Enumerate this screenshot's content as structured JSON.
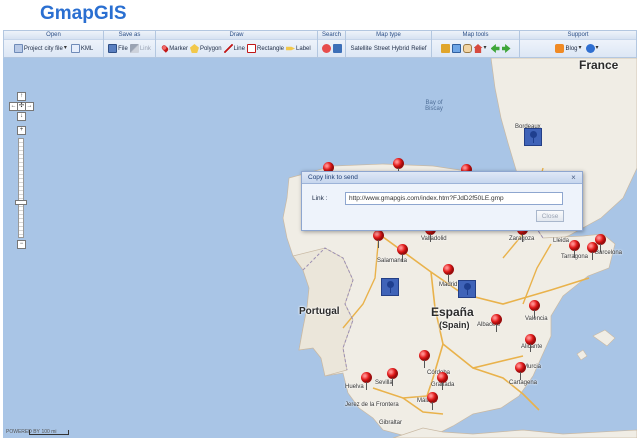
{
  "app": {
    "title": "GmapGIS"
  },
  "toolbar": {
    "groups": [
      {
        "title": "Open",
        "items": [
          {
            "label": "Project",
            "icon": "project-icon"
          },
          {
            "label": "city file",
            "icon": "dropdown-icon"
          },
          {
            "label": "KML",
            "icon": "kml-icon"
          }
        ]
      },
      {
        "title": "Save as",
        "items": [
          {
            "label": "File",
            "icon": "save-icon"
          },
          {
            "label": "Link",
            "icon": "link-icon",
            "disabled": true
          }
        ]
      },
      {
        "title": "Draw",
        "items": [
          {
            "label": "Marker",
            "icon": "marker-icon"
          },
          {
            "label": "Polygon",
            "icon": "polygon-icon"
          },
          {
            "label": "Line",
            "icon": "line-icon"
          },
          {
            "label": "Rectangle",
            "icon": "rectangle-icon"
          },
          {
            "label": "Label",
            "icon": "label-icon"
          }
        ]
      },
      {
        "title": "Search",
        "items": [
          {
            "label": "",
            "icon": "search-icon"
          },
          {
            "label": "",
            "icon": "binoculars-icon"
          }
        ]
      },
      {
        "title": "Map type",
        "items": [
          {
            "label": "Satellite"
          },
          {
            "label": "Street"
          },
          {
            "label": "Hybrid"
          },
          {
            "label": "Relief"
          }
        ]
      },
      {
        "title": "Map tools",
        "items": [
          {
            "label": "",
            "icon": "wrench-icon"
          },
          {
            "label": "",
            "icon": "select-icon"
          },
          {
            "label": "",
            "icon": "hand-icon"
          },
          {
            "label": "",
            "icon": "home-icon"
          },
          {
            "label": "",
            "icon": "dropdown-icon"
          },
          {
            "label": "",
            "icon": "back-arrow-icon"
          },
          {
            "label": "",
            "icon": "forward-arrow-icon"
          }
        ]
      },
      {
        "title": "Support",
        "items": [
          {
            "label": "Blog",
            "icon": "blog-icon"
          },
          {
            "label": "",
            "icon": "dropdown-icon"
          },
          {
            "label": "",
            "icon": "help-icon"
          },
          {
            "label": "",
            "icon": "dropdown-icon"
          }
        ]
      }
    ]
  },
  "map": {
    "countries": [
      {
        "key": "france",
        "label": "France"
      },
      {
        "key": "portugal",
        "label": "Portugal"
      },
      {
        "key": "spain",
        "label": "España",
        "sub": "(Spain)"
      }
    ],
    "seas": [
      {
        "label": "Bay of Biscay"
      }
    ],
    "cities": [
      {
        "key": "bordeaux",
        "label": "Bordeaux"
      },
      {
        "key": "valladolid",
        "label": "Valladolid"
      },
      {
        "key": "zaragoza",
        "label": "Zaragoza"
      },
      {
        "key": "lleida",
        "label": "Lleida"
      },
      {
        "key": "barcelona",
        "label": "Barcelona"
      },
      {
        "key": "tarragona",
        "label": "Tarragona"
      },
      {
        "key": "salamanca",
        "label": "Salamanca"
      },
      {
        "key": "madrid",
        "label": "Madrid"
      },
      {
        "key": "valencia",
        "label": "Valencia"
      },
      {
        "key": "alicante",
        "label": "Alicante"
      },
      {
        "key": "albacete",
        "label": "Albacete"
      },
      {
        "key": "murcia",
        "label": "Murcia"
      },
      {
        "key": "cartagena",
        "label": "Cartagena"
      },
      {
        "key": "cordoba",
        "label": "Córdoba"
      },
      {
        "key": "granada",
        "label": "Granada"
      },
      {
        "key": "sevilla",
        "label": "Sevilla"
      },
      {
        "key": "huelva",
        "label": "Huelva"
      },
      {
        "key": "malaga",
        "label": "Málaga"
      },
      {
        "key": "jerez",
        "label": "Jerez de la Frontera"
      },
      {
        "key": "gibraltar",
        "label": "Gibraltar"
      }
    ]
  },
  "dialog": {
    "title": "Copy link to send",
    "close_symbol": "×",
    "link_label": "Link :",
    "link_value": "http://www.gmapgis.com/index.htm?FJdD2f50LE.gmp",
    "close_button": "Close"
  },
  "footer": {
    "powered_by": "POWERED BY",
    "scale": "100 mi"
  },
  "colors": {
    "accent": "#2a6fd1",
    "sea": "#a9c5e6",
    "land": "#f0ede5",
    "marker": "#e01818"
  }
}
